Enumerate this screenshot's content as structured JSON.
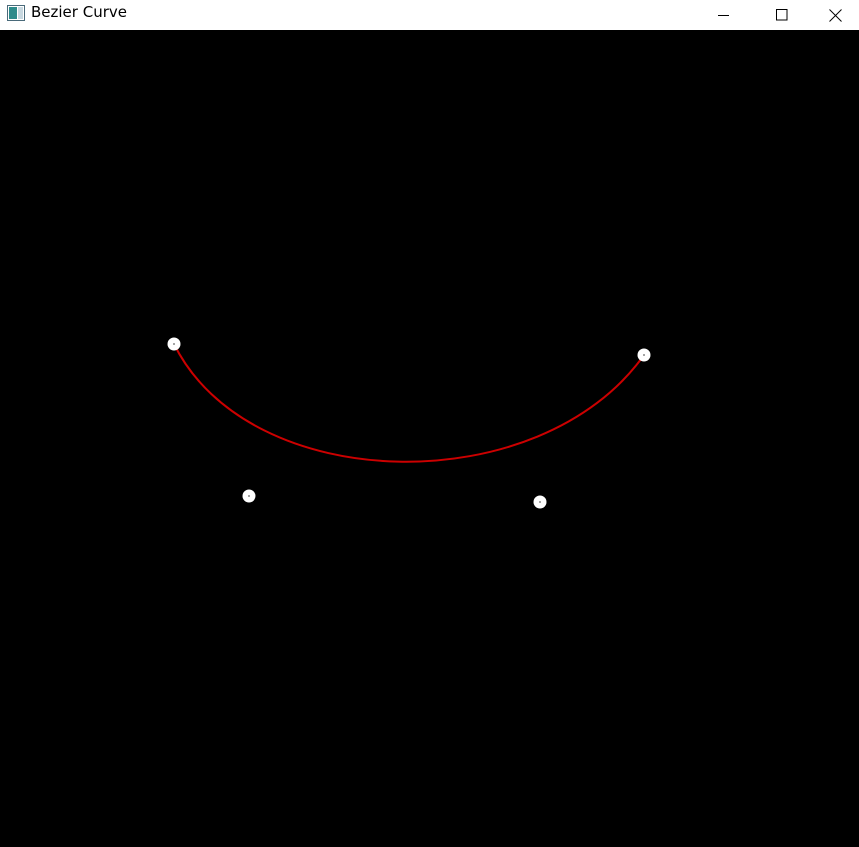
{
  "window": {
    "title": "Bezier Curve",
    "titlebar_color": "#ffffff",
    "canvas_color": "#000000"
  },
  "controls": {
    "minimize_icon": "minimize-icon",
    "maximize_icon": "maximize-icon",
    "close_icon": "close-icon"
  },
  "curve": {
    "color": "#cc0000",
    "point_color": "#ffffff"
  }
}
